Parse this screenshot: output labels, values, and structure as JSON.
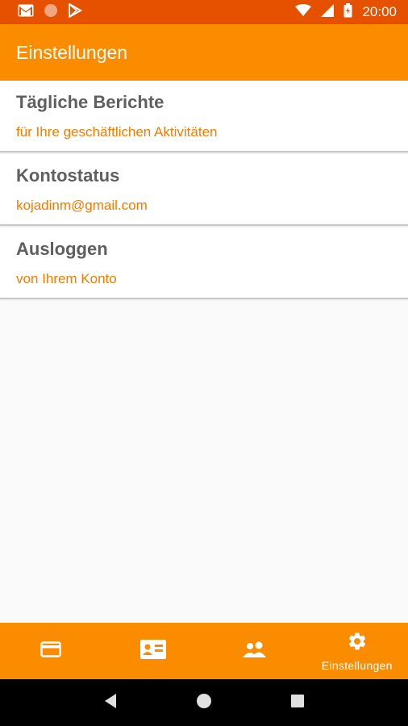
{
  "status_bar": {
    "time": "20:00",
    "icons_left": [
      "gmail-icon",
      "notification-dot-icon",
      "play-store-icon"
    ],
    "icons_right": [
      "wifi-icon",
      "signal-icon",
      "battery-icon"
    ],
    "background_color": "#e65100"
  },
  "app_bar": {
    "title": "Einstellungen",
    "background_color": "#fb8c00"
  },
  "settings": {
    "items": [
      {
        "title": "Tägliche Berichte",
        "subtitle": "für Ihre geschäftlichen Aktivitäten"
      },
      {
        "title": "Kontostatus",
        "subtitle": "kojadinm@gmail.com"
      },
      {
        "title": "Ausloggen",
        "subtitle": "von Ihrem Konto"
      }
    ],
    "subtitle_color": "#f57c00"
  },
  "bottom_nav": {
    "items": [
      {
        "icon": "credit-card-icon",
        "label": ""
      },
      {
        "icon": "contact-card-icon",
        "label": ""
      },
      {
        "icon": "people-icon",
        "label": ""
      },
      {
        "icon": "gear-icon",
        "label": "Einstellungen",
        "selected": true
      }
    ]
  },
  "system_nav": {
    "buttons": [
      "back-icon",
      "home-icon",
      "recents-icon"
    ]
  }
}
